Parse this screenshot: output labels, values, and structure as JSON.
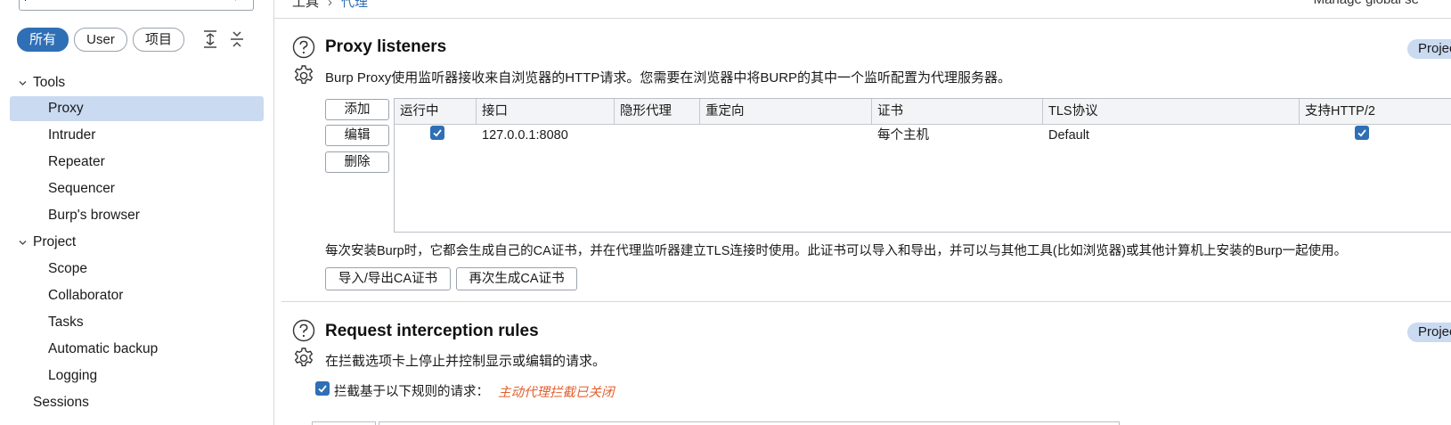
{
  "sidebar": {
    "filters": [
      "所有",
      "User",
      "项目"
    ],
    "tree": [
      {
        "label": "Tools",
        "level": 0,
        "expandable": true
      },
      {
        "label": "Proxy",
        "level": 1,
        "selected": true
      },
      {
        "label": "Intruder",
        "level": 1
      },
      {
        "label": "Repeater",
        "level": 1
      },
      {
        "label": "Sequencer",
        "level": 1
      },
      {
        "label": "Burp's browser",
        "level": 1
      },
      {
        "label": "Project",
        "level": 0,
        "expandable": true
      },
      {
        "label": "Scope",
        "level": 1
      },
      {
        "label": "Collaborator",
        "level": 1
      },
      {
        "label": "Tasks",
        "level": 1
      },
      {
        "label": "Automatic backup",
        "level": 1
      },
      {
        "label": "Logging",
        "level": 1
      },
      {
        "label": "Sessions",
        "level": 0
      }
    ]
  },
  "header": {
    "breadcrumb_root": "工具",
    "breadcrumb_current": "代理",
    "right_text": "Manage global se"
  },
  "proxy_listeners": {
    "title": "Proxy listeners",
    "scope_badge": "Projec",
    "description": "Burp Proxy使用监听器接收来自浏览器的HTTP请求。您需要在浏览器中将BURP的其中一个监听配置为代理服务器。",
    "buttons": {
      "add": "添加",
      "edit": "编辑",
      "delete": "删除"
    },
    "columns": [
      "运行中",
      "接口",
      "隐形代理",
      "重定向",
      "证书",
      "TLS协议",
      "支持HTTP/2"
    ],
    "rows": [
      {
        "running": true,
        "interface": "127.0.0.1:8080",
        "invisible": "",
        "redirect": "",
        "certificate": "每个主机",
        "tls": "Default",
        "http2": true
      }
    ],
    "ca_note": "每次安装Burp时，它都会生成自己的CA证书，并在代理监听器建立TLS连接时使用。此证书可以导入和导出，并可以与其他工具(比如浏览器)或其他计算机上安装的Burp一起使用。",
    "ca_buttons": {
      "import_export": "导入/导出CA证书",
      "regenerate": "再次生成CA证书"
    }
  },
  "interception": {
    "title": "Request interception rules",
    "scope_badge": "Projec",
    "description": "在拦截选项卡上停止并控制显示或编辑的请求。",
    "checkbox_label": "拦截基于以下规则的请求：",
    "checkbox_checked": true,
    "status": "主动代理拦截已关闭"
  },
  "colors": {
    "accent": "#2f6fb5",
    "selection": "#c9daf1",
    "warning": "#e2602f"
  }
}
